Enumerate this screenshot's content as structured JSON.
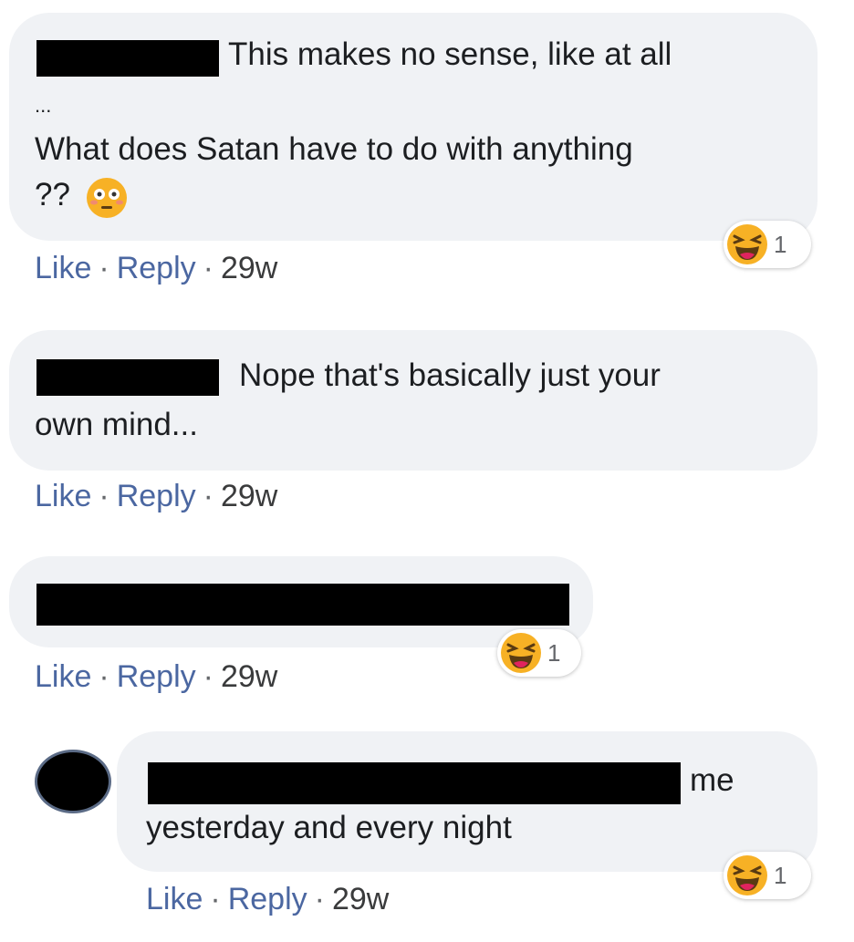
{
  "comments": [
    {
      "line1": "This makes no sense, like at all",
      "line2": "...",
      "line3": "What does Satan have to do with anything",
      "line4": "??",
      "actions": {
        "like": "Like",
        "reply": "Reply",
        "time": "29w"
      },
      "reaction": {
        "icon": "haha-emoji-icon",
        "count": "1"
      }
    },
    {
      "line1": "Nope that's basically just your",
      "line2": "own mind...",
      "actions": {
        "like": "Like",
        "reply": "Reply",
        "time": "29w"
      }
    },
    {
      "actions": {
        "like": "Like",
        "reply": "Reply",
        "time": "29w"
      },
      "reaction": {
        "icon": "haha-emoji-icon",
        "count": "1"
      }
    },
    {
      "line1": "me",
      "line2": "yesterday and every night",
      "actions": {
        "like": "Like",
        "reply": "Reply",
        "time": "29w"
      },
      "reaction": {
        "icon": "haha-emoji-icon",
        "count": "1"
      }
    }
  ],
  "colors": {
    "bubble": "#f0f2f5",
    "link": "#4b67a1",
    "emoji": "#f7b125"
  }
}
